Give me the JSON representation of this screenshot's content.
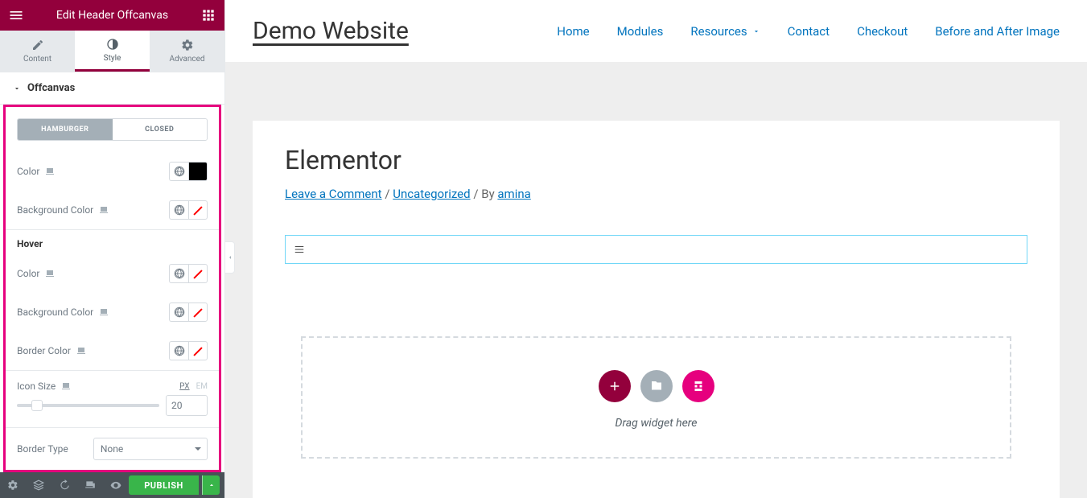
{
  "header": {
    "title": "Edit Header Offcanvas"
  },
  "tabs": {
    "content": "Content",
    "style": "Style",
    "advanced": "Advanced"
  },
  "section": "Offcanvas",
  "toggle": {
    "hamburger": "HAMBURGER",
    "closed": "CLOSED"
  },
  "controls": {
    "color": "Color",
    "bgColor": "Background Color",
    "hover": "Hover",
    "borderColor": "Border Color",
    "iconSize": "Icon Size",
    "iconSizeVal": "20",
    "borderType": "Border Type",
    "borderTypeVal": "None",
    "px": "PX",
    "em": "EM"
  },
  "footer": {
    "publish": "PUBLISH"
  },
  "site": {
    "title": "Demo Website",
    "nav": [
      "Home",
      "Modules",
      "Resources",
      "Contact",
      "Checkout",
      "Before and After Image"
    ],
    "pageTitle": "Elementor",
    "meta": {
      "leaveComment": "Leave a Comment",
      "sep1": "/",
      "category": "Uncategorized",
      "by": "/ By",
      "author": "amina"
    },
    "dropzone": "Drag widget here"
  }
}
